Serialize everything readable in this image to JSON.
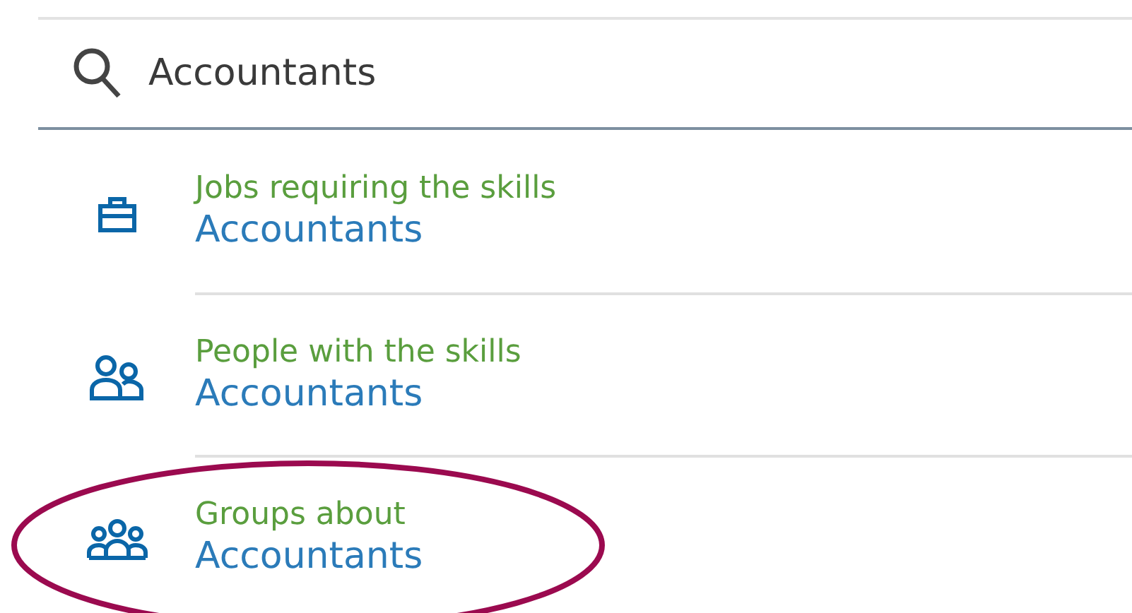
{
  "search": {
    "value": "Accountants"
  },
  "suggestions": [
    {
      "kind": "jobs",
      "title": "Jobs requiring the skills",
      "query": "Accountants",
      "circled": false
    },
    {
      "kind": "people",
      "title": "People with the skills",
      "query": "Accountants",
      "circled": false
    },
    {
      "kind": "groups",
      "title": "Groups about",
      "query": "Accountants",
      "circled": true
    }
  ]
}
